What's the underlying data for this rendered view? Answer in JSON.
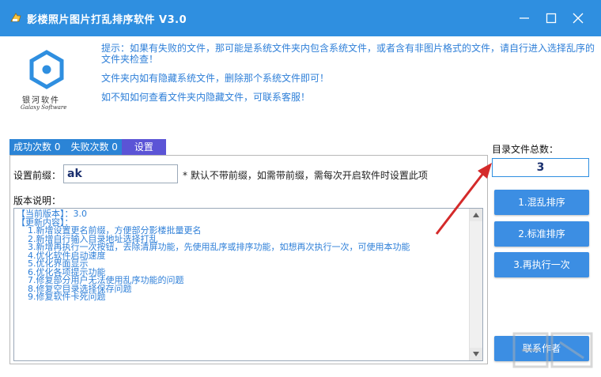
{
  "window": {
    "title": "影楼照片图片打乱排序软件 V3.0"
  },
  "logo": {
    "name": "银河软件",
    "subtitle": "Galaxy Software"
  },
  "tips": {
    "line1": "提示：如果有失败的文件，那可能是系统文件夹内包含系统文件，或者含有非图片格式的文件，请自行进入选择乱序的文件夹检查！",
    "line2": "文件夹内如有隐藏系统文件，删除那个系统文件即可！",
    "line3": "如不知如何查看文件夹内隐藏文件，可联系客服！"
  },
  "tabs": [
    {
      "label": "成功次数 0"
    },
    {
      "label": "失败次数 0"
    },
    {
      "label": "设置"
    }
  ],
  "settings": {
    "prefix_label": "设置前缀：",
    "prefix_value": "ak",
    "prefix_note": "* 默认不带前缀，如需带前缀，需每次开启软件时设置此项",
    "version_label": "版本说明："
  },
  "version_notes": [
    "【当前版本】：3.0",
    "【更新内容】：",
    "1.新增设置更名前缀，方便部分影楼批量更名",
    "2.新增自行输入目录地址选择打乱",
    "3.新增再执行一次按钮，去除清屏功能，先使用乱序或排序功能，如想再次执行一次，可使用本功能",
    "4.优化软件启动速度",
    "5.优化界面显示",
    "6.优化各项提示功能",
    "7.修复部分用户无法使用乱序功能的问题",
    "8.修复空目录选择保存问题",
    "9.修复软件卡死问题"
  ],
  "right_panel": {
    "count_label": "目录文件总数：",
    "count_value": "3",
    "btn_shuffle": "1.混乱排序",
    "btn_standard": "2.标准排序",
    "btn_again": "3.再执行一次",
    "btn_contact": "联系作者"
  },
  "colors": {
    "titlebar": "#2f8fe0",
    "accent_text": "#2e7fd8",
    "tab_active": "#5b54d6",
    "button": "#3c8ee3",
    "arrow": "#d42a2a"
  }
}
